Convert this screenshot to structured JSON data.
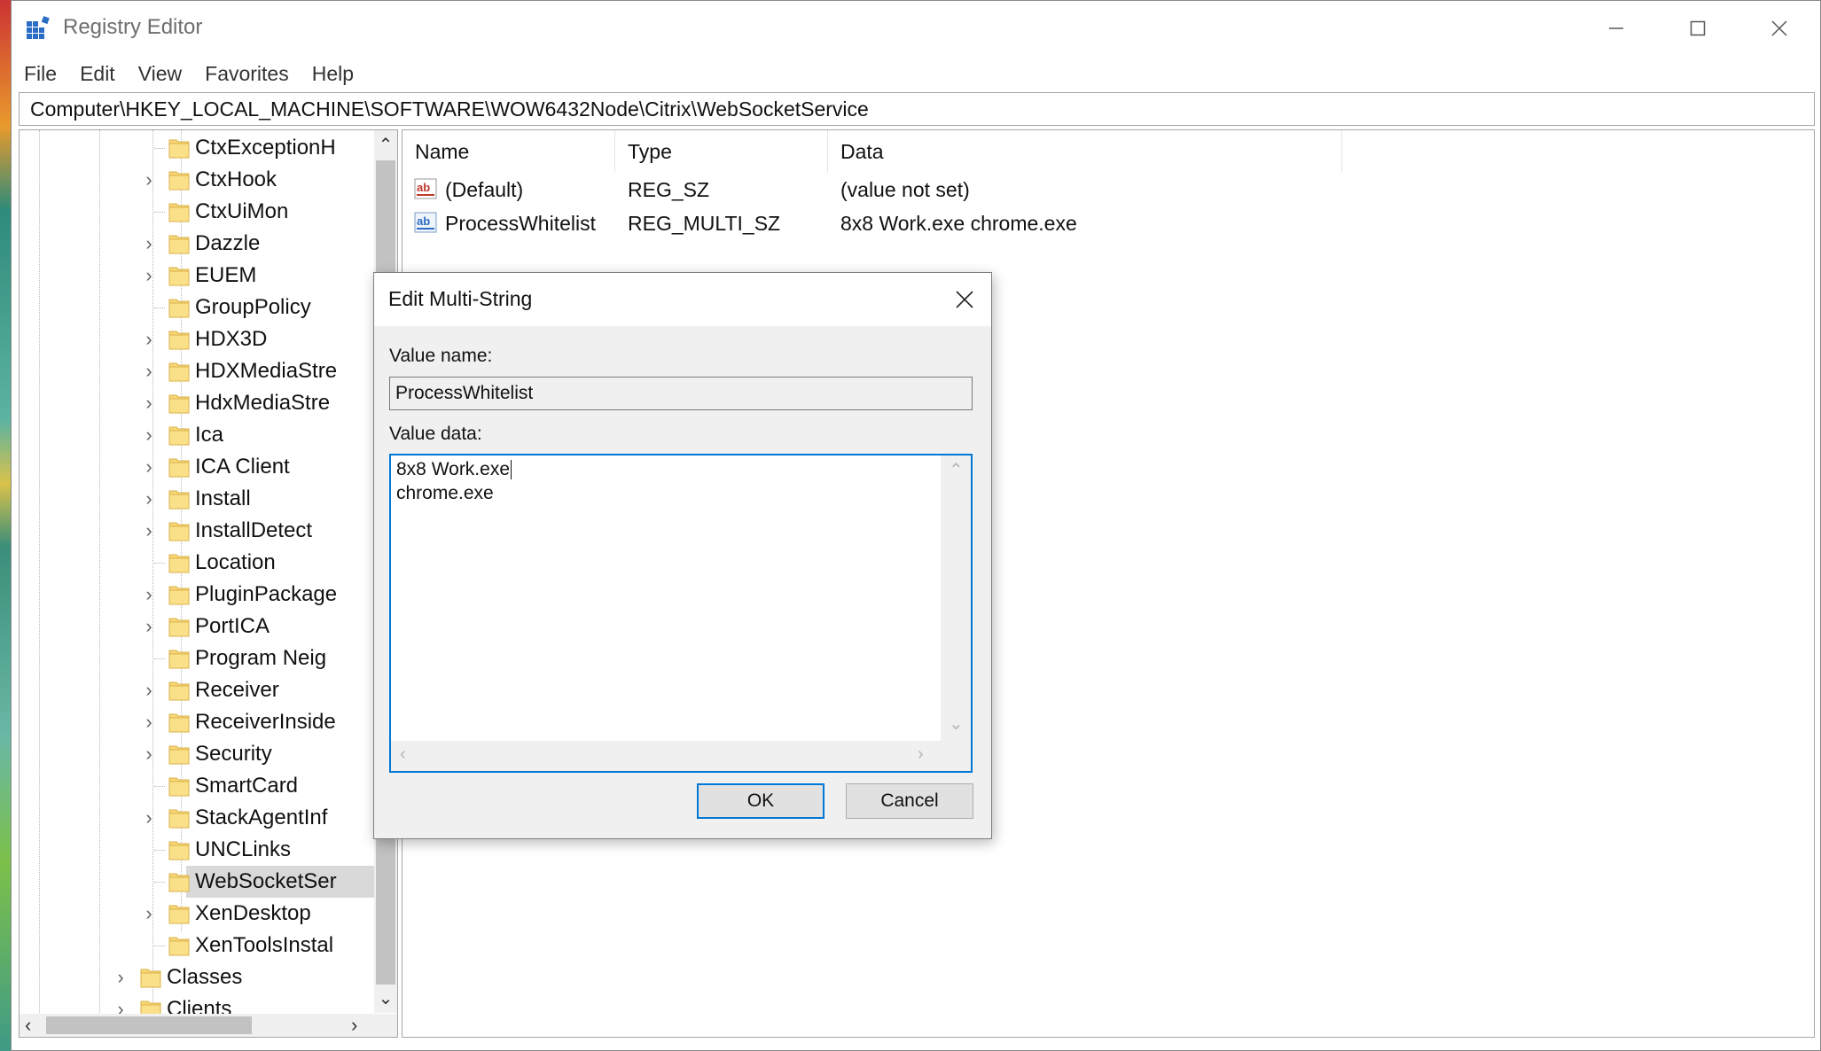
{
  "window": {
    "title": "Registry Editor",
    "controls": {
      "minimize": "minimize",
      "maximize": "maximize",
      "close": "close"
    }
  },
  "menu": [
    "File",
    "Edit",
    "View",
    "Favorites",
    "Help"
  ],
  "address": "Computer\\HKEY_LOCAL_MACHINE\\SOFTWARE\\WOW6432Node\\Citrix\\WebSocketService",
  "tree": {
    "items": [
      {
        "label": "CtxExceptionH",
        "expandable": false
      },
      {
        "label": "CtxHook",
        "expandable": true
      },
      {
        "label": "CtxUiMon",
        "expandable": false
      },
      {
        "label": "Dazzle",
        "expandable": true
      },
      {
        "label": "EUEM",
        "expandable": true
      },
      {
        "label": "GroupPolicy",
        "expandable": false
      },
      {
        "label": "HDX3D",
        "expandable": true
      },
      {
        "label": "HDXMediaStre",
        "expandable": true
      },
      {
        "label": "HdxMediaStre",
        "expandable": true
      },
      {
        "label": "Ica",
        "expandable": true
      },
      {
        "label": "ICA Client",
        "expandable": true
      },
      {
        "label": "Install",
        "expandable": true
      },
      {
        "label": "InstallDetect",
        "expandable": true
      },
      {
        "label": "Location",
        "expandable": false
      },
      {
        "label": "PluginPackage",
        "expandable": true
      },
      {
        "label": "PortICA",
        "expandable": true
      },
      {
        "label": "Program Neig",
        "expandable": false
      },
      {
        "label": "Receiver",
        "expandable": true
      },
      {
        "label": "ReceiverInside",
        "expandable": true
      },
      {
        "label": "Security",
        "expandable": true
      },
      {
        "label": "SmartCard",
        "expandable": false
      },
      {
        "label": "StackAgentInf",
        "expandable": true
      },
      {
        "label": "UNCLinks",
        "expandable": false
      },
      {
        "label": "WebSocketSer",
        "expandable": false,
        "selected": true
      },
      {
        "label": "XenDesktop",
        "expandable": true
      },
      {
        "label": "XenToolsInstal",
        "expandable": false
      }
    ],
    "parent_items": [
      {
        "label": "Classes",
        "expandable": true
      },
      {
        "label": "Clients",
        "expandable": true
      }
    ]
  },
  "values": {
    "columns": [
      "Name",
      "Type",
      "Data"
    ],
    "rows": [
      {
        "name": "(Default)",
        "type": "REG_SZ",
        "data": "(value not set)",
        "icon": "string-value-icon"
      },
      {
        "name": "ProcessWhitelist",
        "type": "REG_MULTI_SZ",
        "data": "8x8 Work.exe chrome.exe",
        "icon": "multi-string-value-icon"
      }
    ]
  },
  "dialog": {
    "title": "Edit Multi-String",
    "value_name_label": "Value name:",
    "value_name": "ProcessWhitelist",
    "value_data_label": "Value data:",
    "value_data_lines": [
      "8x8 Work.exe",
      "chrome.exe"
    ],
    "ok_label": "OK",
    "cancel_label": "Cancel"
  },
  "colors": {
    "accent": "#0078d7",
    "folder": "#f8d775",
    "selection": "#d9d9d9"
  }
}
